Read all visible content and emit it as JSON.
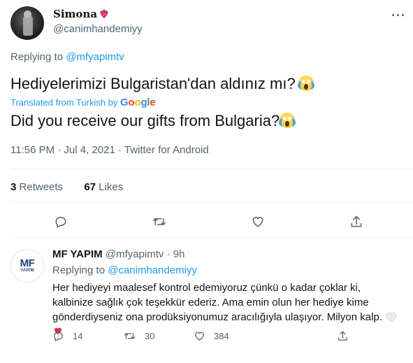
{
  "main_tweet": {
    "author_name": "Simona",
    "author_handle": "@canimhandemiyy",
    "more_label": "···",
    "replying_prefix": "Replying to",
    "replying_to": "@mfyapimtv",
    "text": "Hediyelerimizi Bulgaristan'dan aldınız mı?",
    "translated_from": "Translated from Turkish by",
    "translator": "Google",
    "translation": "Did you receive our gifts from Bulgaria?",
    "timestamp": "11:56 PM · Jul 4, 2021 · Twitter for Android",
    "retweets_count": "3",
    "retweets_label": "Retweets",
    "likes_count": "67",
    "likes_label": "Likes",
    "icons": [
      "reply-icon",
      "retweet-icon",
      "like-icon",
      "share-icon"
    ]
  },
  "reply": {
    "avatar_text": "MF",
    "avatar_subtext": "YAPIM",
    "author_name": "MF YAPIM",
    "author_handle": "@mfyapimtv",
    "time": "· 9h",
    "replying_prefix": "Replying to",
    "replying_to": "@canimhandemiyy",
    "text": "Her hediyeyi maalesef kontrol edemiyoruz çünkü o kadar çoklar ki, kalbinize sağlık çok teşekkür ederiz. Ama emin olun her hediye kime gönderdiyseniz ona prodüksiyonumuz aracılığıyla ulaşıyor. Milyon kalp.",
    "reply_count": "14",
    "retweet_count": "30",
    "like_count": "384"
  },
  "colors": {
    "link": "#1d9bf0",
    "secondary_text": "#536471",
    "divider": "#eff3f4",
    "google_blue": "#4285f4",
    "google_red": "#ea4335",
    "google_yellow": "#fbbc05",
    "google_green": "#34a853"
  }
}
